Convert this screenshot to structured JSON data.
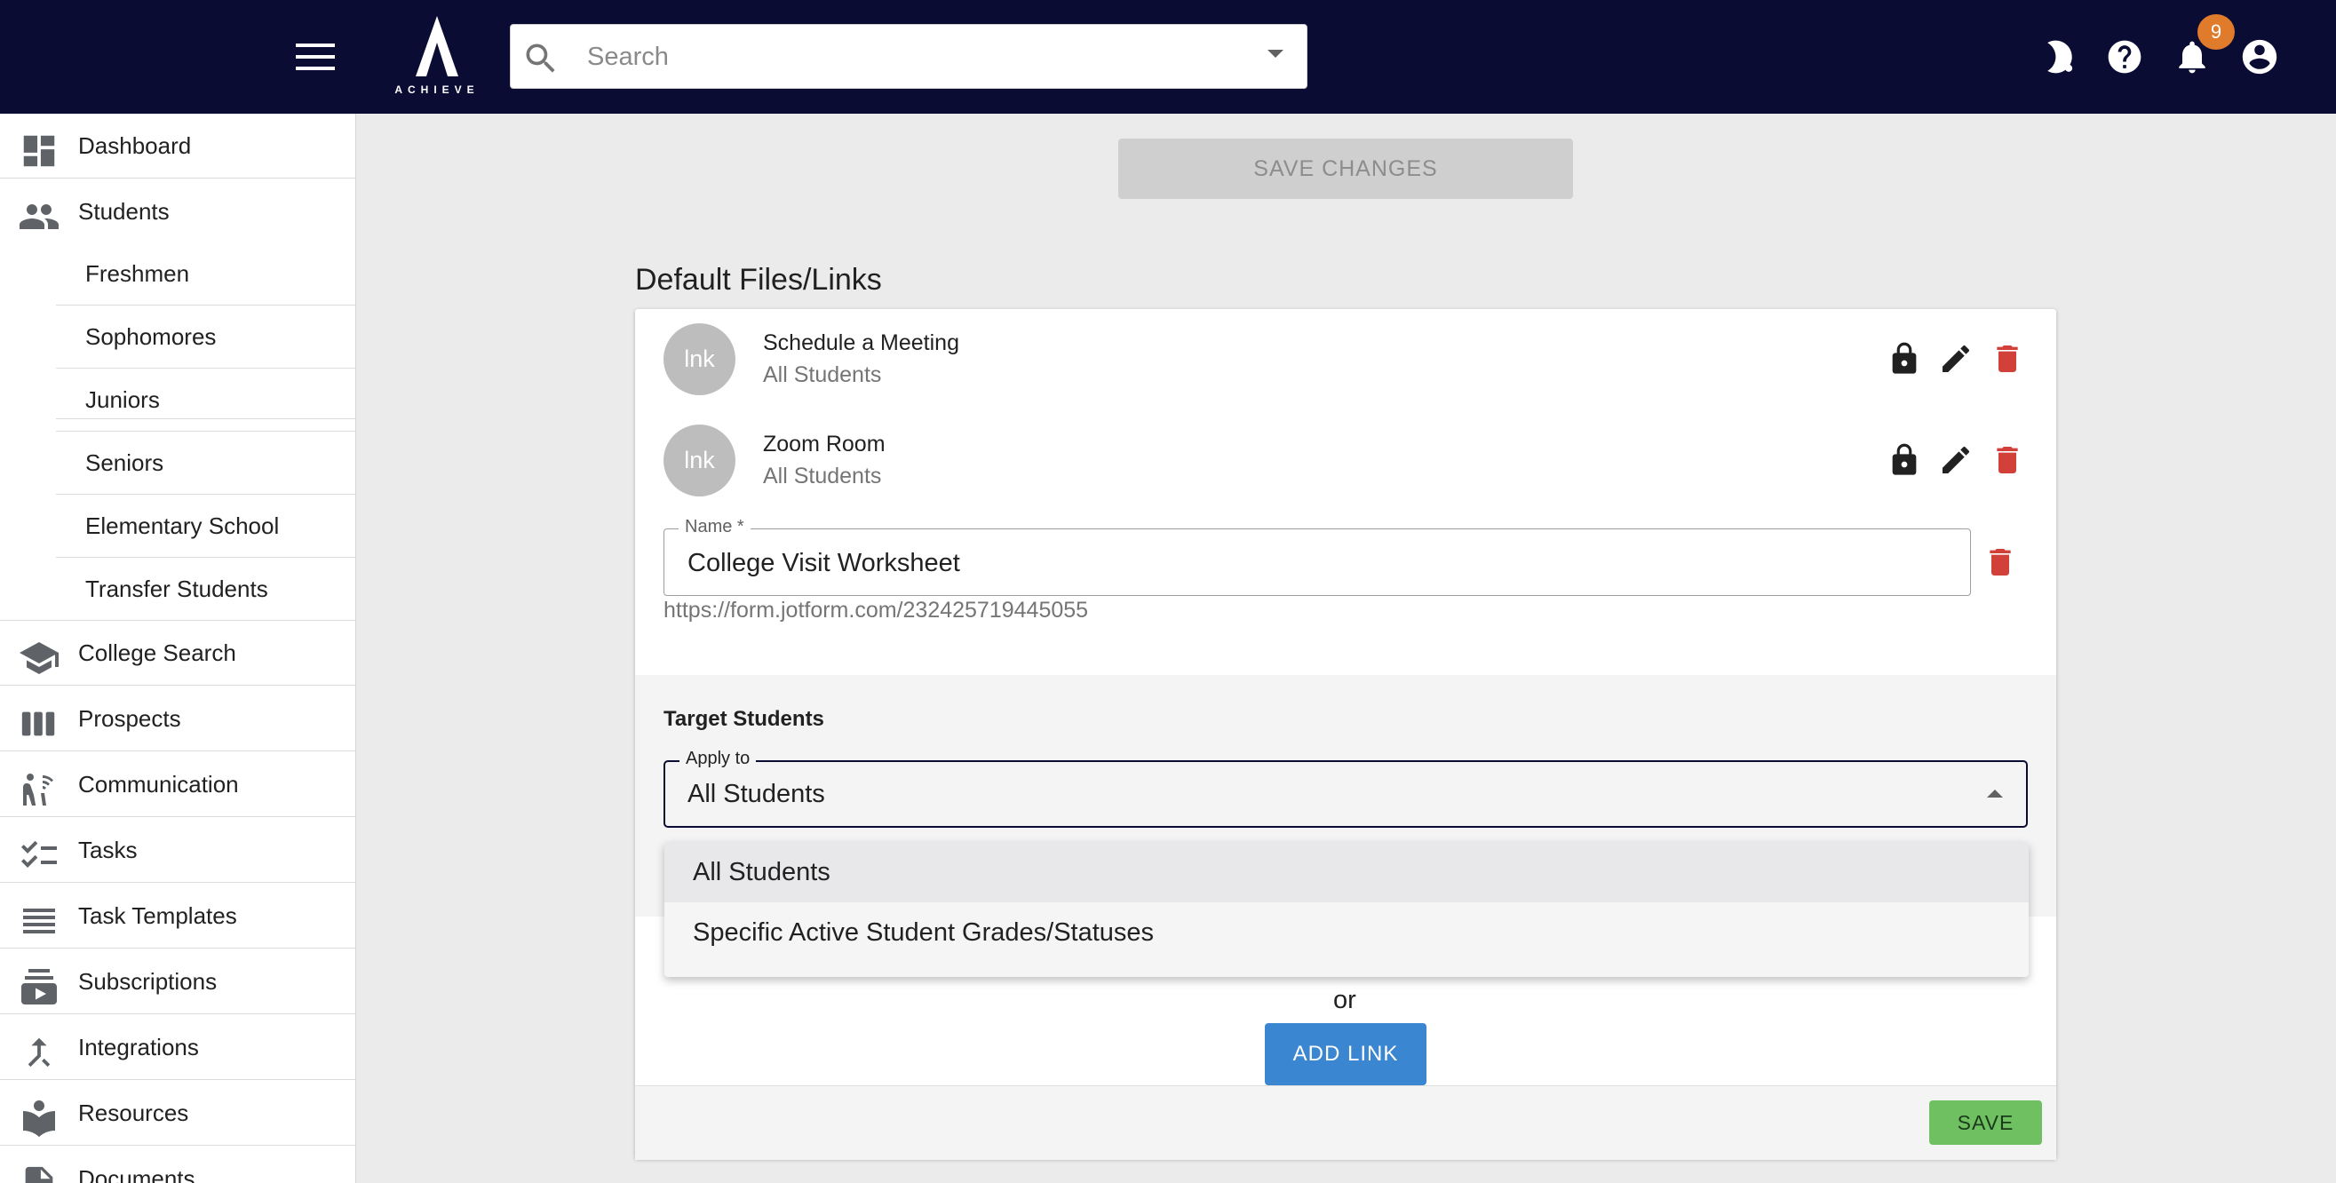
{
  "app": {
    "logo_text": "ACHIEVE",
    "notification_count": "9"
  },
  "search": {
    "placeholder": "Search",
    "value": ""
  },
  "sidebar": {
    "items": [
      {
        "label": "Dashboard",
        "icon": "dashboard-icon"
      },
      {
        "label": "Students",
        "icon": "people-icon"
      },
      {
        "label": "College Search",
        "icon": "school-icon"
      },
      {
        "label": "Prospects",
        "icon": "view-week-icon"
      },
      {
        "label": "Communication",
        "icon": "communication-icon"
      },
      {
        "label": "Tasks",
        "icon": "checklist-icon"
      },
      {
        "label": "Task Templates",
        "icon": "list-icon"
      },
      {
        "label": "Subscriptions",
        "icon": "subscriptions-icon"
      },
      {
        "label": "Integrations",
        "icon": "merge-icon"
      },
      {
        "label": "Resources",
        "icon": "resources-icon"
      },
      {
        "label": "Documents",
        "icon": "document-icon"
      }
    ],
    "student_subitems": [
      "Freshmen",
      "Sophomores",
      "Juniors",
      "Seniors",
      "Elementary School",
      "Transfer Students"
    ]
  },
  "main": {
    "save_changes_label": "SAVE CHANGES",
    "section_title": "Default Files/Links",
    "links": [
      {
        "avatar": "lnk",
        "title": "Schedule a Meeting",
        "subtitle": "All Students"
      },
      {
        "avatar": "lnk",
        "title": "Zoom Room",
        "subtitle": "All Students"
      }
    ],
    "name_field": {
      "label": "Name *",
      "value": "College Visit Worksheet"
    },
    "url": "https://form.jotform.com/232425719445055",
    "target_title": "Target Students",
    "apply_to": {
      "label": "Apply to",
      "value": "All Students"
    },
    "or_text": "or",
    "add_link_label": "ADD LINK",
    "save_label": "SAVE"
  },
  "dropdown": {
    "options": [
      "All Students",
      "Specific Active Student Grades/Statuses"
    ],
    "selected": "All Students"
  },
  "colors": {
    "topbar": "#0a0c33",
    "delete": "#d2403a",
    "primary_button": "#3b86d0",
    "save_button": "#6fc060",
    "badge": "#e07b2b"
  }
}
